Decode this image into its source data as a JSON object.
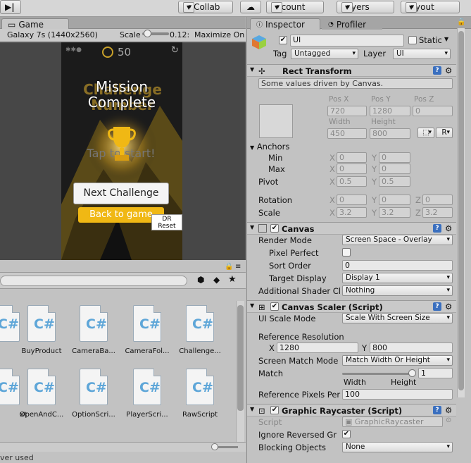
{
  "toolbar": {
    "step_icon": "step-icon",
    "collab_label": "Collab",
    "cloud_icon": "cloud-icon",
    "account_label": "Account",
    "layers_label": "Layers",
    "layout_label": "Layout"
  },
  "game": {
    "tab_label": "Game",
    "resolution": "Galaxy 7s (1440x2560)",
    "scale_label": "Scale",
    "scale_value": "0.12:",
    "maximize_label": "Maximize On",
    "score": "50",
    "mission_line1": "Mission",
    "mission_line2": "Complete",
    "bg_title": "Challenge Number",
    "tap_text": "Tap to start!",
    "next_button": "Next Challenge",
    "back_button": "Back to game",
    "dr_reset_line1": "DR",
    "dr_reset_line2": "Reset"
  },
  "project": {
    "files_row1": [
      "BuyProduct",
      "CameraBa...",
      "CameraFol...",
      "Challenge..."
    ],
    "files_row2": [
      "xt",
      "OpenAndC...",
      "OptionScri...",
      "PlayerScri...",
      "RawScript"
    ],
    "file_glyph": "C#",
    "status_text": "ver used"
  },
  "inspector": {
    "tab_label": "Inspector",
    "profiler_label": "Profiler",
    "object_name": "UI",
    "static_label": "Static",
    "tag_label": "Tag",
    "tag_value": "Untagged",
    "layer_label": "Layer",
    "layer_value": "UI",
    "rect": {
      "title": "Rect Transform",
      "note": "Some values driven by Canvas.",
      "posx_label": "Pos X",
      "posy_label": "Pos Y",
      "posz_label": "Pos Z",
      "posx": "720",
      "posy": "1280",
      "posz": "0",
      "width_label": "Width",
      "height_label": "Height",
      "width": "450",
      "height": "800",
      "r_button": "R",
      "anchors_label": "Anchors",
      "min_label": "Min",
      "max_label": "Max",
      "min_x": "0",
      "min_y": "0",
      "max_x": "0",
      "max_y": "0",
      "pivot_label": "Pivot",
      "pivot_x": "0.5",
      "pivot_y": "0.5",
      "rotation_label": "Rotation",
      "rot_x": "0",
      "rot_y": "0",
      "rot_z": "0",
      "scale_label": "Scale",
      "scale_x": "3.2",
      "scale_y": "3.2",
      "scale_z": "3.2",
      "x": "X",
      "y": "Y",
      "z": "Z"
    },
    "canvas": {
      "title": "Canvas",
      "render_mode_label": "Render Mode",
      "render_mode": "Screen Space - Overlay",
      "pixel_perfect_label": "Pixel Perfect",
      "sort_order_label": "Sort Order",
      "sort_order": "0",
      "target_display_label": "Target Display",
      "target_display": "Display 1",
      "shader_label": "Additional Shader Cl",
      "shader_value": "Nothing"
    },
    "scaler": {
      "title": "Canvas Scaler (Script)",
      "ui_scale_label": "UI Scale Mode",
      "ui_scale": "Scale With Screen Size",
      "ref_res_label": "Reference Resolution",
      "ref_x": "1280",
      "ref_y": "800",
      "match_mode_label": "Screen Match Mode",
      "match_mode": "Match Width Or Height",
      "match_label": "Match",
      "match_value": "1",
      "width_word": "Width",
      "height_word": "Height",
      "ref_ppu_label": "Reference Pixels Per",
      "ref_ppu": "100"
    },
    "raycaster": {
      "title": "Graphic Raycaster (Script)",
      "script_label": "Script",
      "script_value": "GraphicRaycaster",
      "ignore_label": "Ignore Reversed Gr",
      "blocking_label": "Blocking Objects",
      "blocking_value": "None"
    }
  },
  "colors": {
    "accent_gold": "#f0b814",
    "button_blue": "#3a6fbf"
  }
}
